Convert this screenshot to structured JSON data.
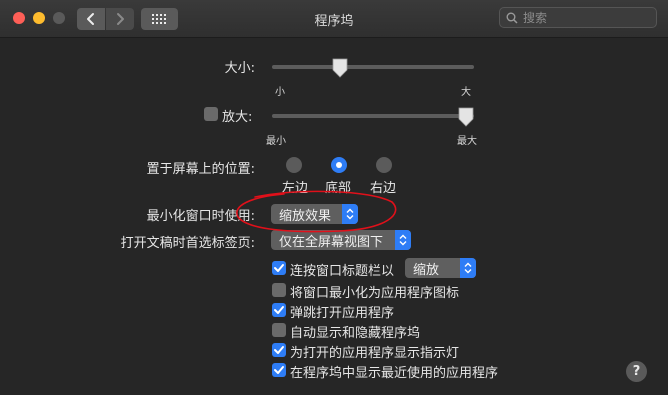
{
  "window": {
    "title": "程序坞",
    "search_placeholder": "搜索"
  },
  "size": {
    "label": "大小:",
    "min_label": "小",
    "max_label": "大",
    "value_fraction": 0.33
  },
  "magnification": {
    "checkbox_label": "放大:",
    "checked": false,
    "min_label": "最小",
    "max_label": "最大",
    "value_fraction": 1.0
  },
  "position": {
    "label": "置于屏幕上的位置:",
    "options": [
      "左边",
      "底部",
      "右边"
    ],
    "selected": "底部"
  },
  "minimize_effect": {
    "label": "最小化窗口时使用:",
    "value": "缩放效果"
  },
  "prefer_tabs": {
    "label": "打开文稿时首选标签页:",
    "value": "仅在全屏幕视图下"
  },
  "double_click": {
    "label": "连按窗口标题栏以",
    "checked": true,
    "value": "缩放"
  },
  "options": [
    {
      "label": "将窗口最小化为应用程序图标",
      "checked": false
    },
    {
      "label": "弹跳打开应用程序",
      "checked": true
    },
    {
      "label": "自动显示和隐藏程序坞",
      "checked": false
    },
    {
      "label": "为打开的应用程序显示指示灯",
      "checked": true
    },
    {
      "label": "在程序坞中显示最近使用的应用程序",
      "checked": true
    }
  ],
  "help_label": "?",
  "colors": {
    "accent": "#2e7df6",
    "annotation": "#e0101a",
    "background": "#262626"
  },
  "icons": {
    "back": "chevron-left-icon",
    "forward": "chevron-right-icon",
    "grid": "grid-icon",
    "search": "magnifier-icon",
    "help": "help-icon",
    "checkmark": "checkmark-icon",
    "popup_arrows": "up-down-arrows-icon"
  }
}
